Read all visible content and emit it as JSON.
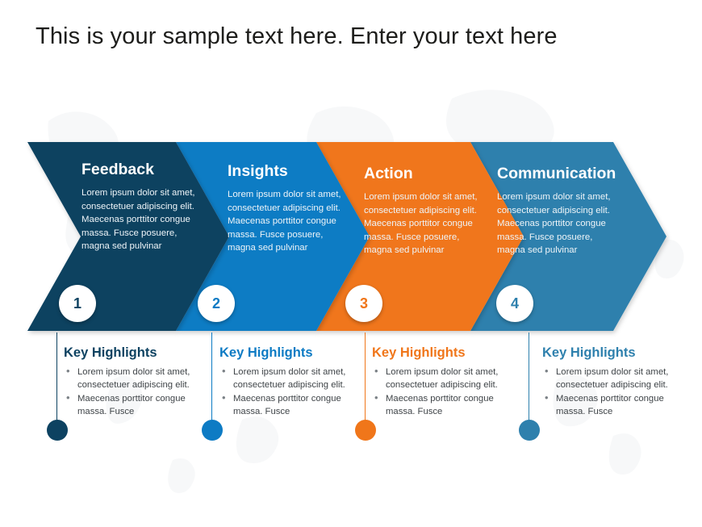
{
  "slide": {
    "title": "This is your sample text here. Enter your text here",
    "background_color": "#ffffff"
  },
  "palette": {
    "navy": "#0d4261",
    "blue": "#0d7bc4",
    "orange": "#f0761a",
    "teal": "#2e80ad"
  },
  "steps": [
    {
      "number": "1",
      "heading": "Feedback",
      "body": "Lorem ipsum dolor sit amet, consectetuer adipiscing elit. Maecenas porttitor congue massa. Fusce posuere, magna sed pulvinar",
      "color": "#0d4261",
      "highlights_title": "Key Highlights",
      "bullets": [
        "Lorem ipsum dolor sit amet, consectetuer adipiscing elit.",
        "Maecenas porttitor congue massa. Fusce"
      ]
    },
    {
      "number": "2",
      "heading": "Insights",
      "body": "Lorem ipsum dolor sit amet, consectetuer adipiscing elit. Maecenas porttitor congue massa. Fusce posuere, magna sed pulvinar",
      "color": "#0d7bc4",
      "highlights_title": "Key Highlights",
      "bullets": [
        "Lorem ipsum dolor sit amet, consectetuer adipiscing elit.",
        "Maecenas porttitor congue massa. Fusce"
      ]
    },
    {
      "number": "3",
      "heading": "Action",
      "body": "Lorem ipsum dolor sit amet, consectetuer adipiscing elit. Maecenas porttitor congue massa. Fusce posuere, magna sed pulvinar",
      "color": "#f0761a",
      "highlights_title": "Key Highlights",
      "bullets": [
        "Lorem ipsum dolor sit amet, consectetuer adipiscing elit.",
        "Maecenas porttitor congue massa. Fusce"
      ]
    },
    {
      "number": "4",
      "heading": "Communication",
      "body": "Lorem ipsum dolor sit amet, consectetuer adipiscing elit. Maecenas porttitor congue massa. Fusce posuere, magna sed pulvinar",
      "color": "#2e80ad",
      "highlights_title": "Key Highlights",
      "bullets": [
        "Lorem ipsum dolor sit amet, consectetuer adipiscing elit.",
        "Maecenas porttitor congue massa. Fusce"
      ]
    }
  ]
}
